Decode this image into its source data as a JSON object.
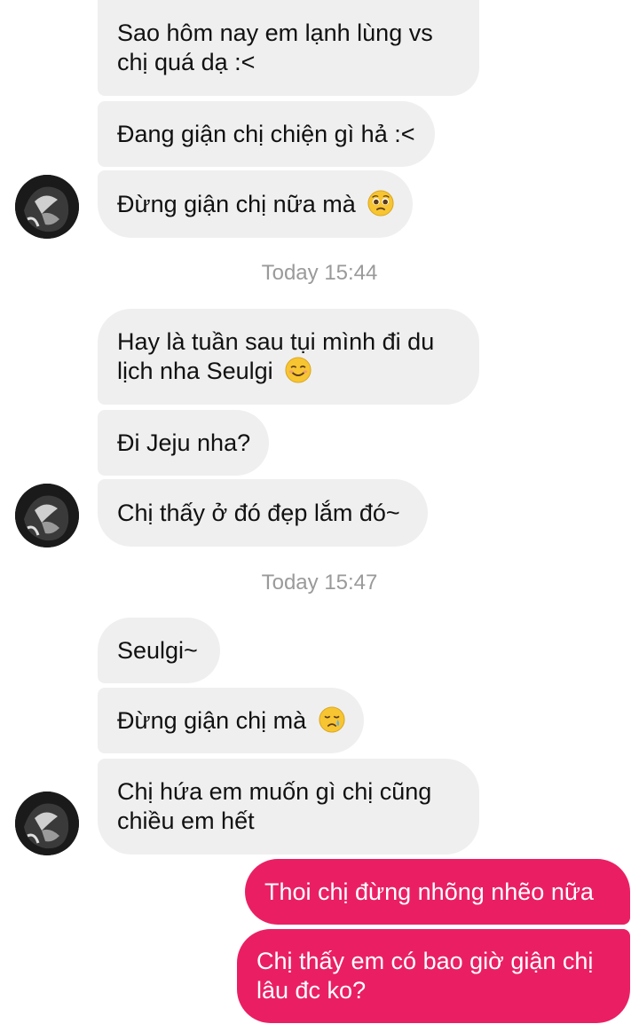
{
  "messages": {
    "group1": {
      "m1_line1": "Sao hôm nay em lạnh lùng vs",
      "m1_line2": "chị quá dạ :<",
      "m2": "Đang giận chị chiện gì hả :<",
      "m3": "Đừng giận chị nữa mà"
    },
    "timestamp1": "Today 15:44",
    "group2": {
      "m1_line1": "Hay là tuần sau tụi mình đi du",
      "m1_line2": "lịch nha Seulgi",
      "m2": "Đi Jeju nha?",
      "m3": "Chị thấy ở đó đẹp lắm đó~"
    },
    "timestamp2": "Today 15:47",
    "group3": {
      "m1": "Seulgi~",
      "m2": "Đừng giận chị mà",
      "m3_line1": "Chị hứa em muốn gì chị cũng",
      "m3_line2": "chiều em hết"
    },
    "outgoing": {
      "m1": "Thoi chị đừng nhõng nhẽo nữa",
      "m2_line1": "Chị thấy em có bao giờ giận chị",
      "m2_line2": "lâu đc ko?"
    }
  },
  "icons": {
    "pleading": "pleading-face-emoji",
    "smiling": "smiling-face-emoji",
    "crying": "crying-face-emoji"
  },
  "colors": {
    "incoming_bubble": "#efefef",
    "outgoing_bubble": "#ea1f63",
    "timestamp": "#9a9a9a"
  }
}
